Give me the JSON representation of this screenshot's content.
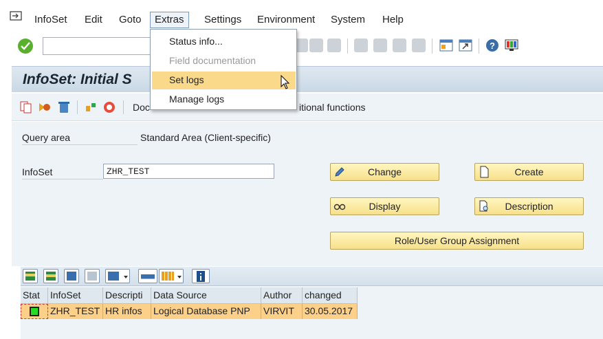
{
  "menubar": {
    "items": [
      "InfoSet",
      "Edit",
      "Goto",
      "Extras",
      "Settings",
      "Environment",
      "System",
      "Help"
    ]
  },
  "extras_menu": {
    "items": [
      {
        "label": "Status info...",
        "state": "enabled"
      },
      {
        "label": "Field documentation",
        "state": "disabled"
      },
      {
        "label": "Set logs",
        "state": "hover"
      },
      {
        "label": "Manage logs",
        "state": "enabled"
      }
    ]
  },
  "title": "InfoSet: Initial S",
  "app_toolbar": {
    "doc_text": "Doc",
    "additional_functions": "itional functions"
  },
  "form": {
    "query_area_label": "Query area",
    "query_area_value": "Standard Area (Client-specific)",
    "infoset_label": "InfoSet",
    "infoset_value": "ZHR_TEST"
  },
  "buttons": {
    "change": "Change",
    "create": "Create",
    "display": "Display",
    "description": "Description",
    "role_assignment": "Role/User Group Assignment"
  },
  "grid": {
    "headers": [
      "Stat",
      "InfoSet",
      "Descripti",
      "Data Source",
      "Author",
      "changed"
    ],
    "rows": [
      {
        "status": "green",
        "infoset": "ZHR_TEST",
        "description": "HR infos",
        "data_source": "Logical Database PNP",
        "author": "VIRVIT",
        "changed": "30.05.2017"
      }
    ]
  },
  "colors": {
    "accent_button": "#f7e08a",
    "row_highlight": "#fdd08a",
    "menu_hover": "#fad98a",
    "status_ok": "#22dd22"
  }
}
